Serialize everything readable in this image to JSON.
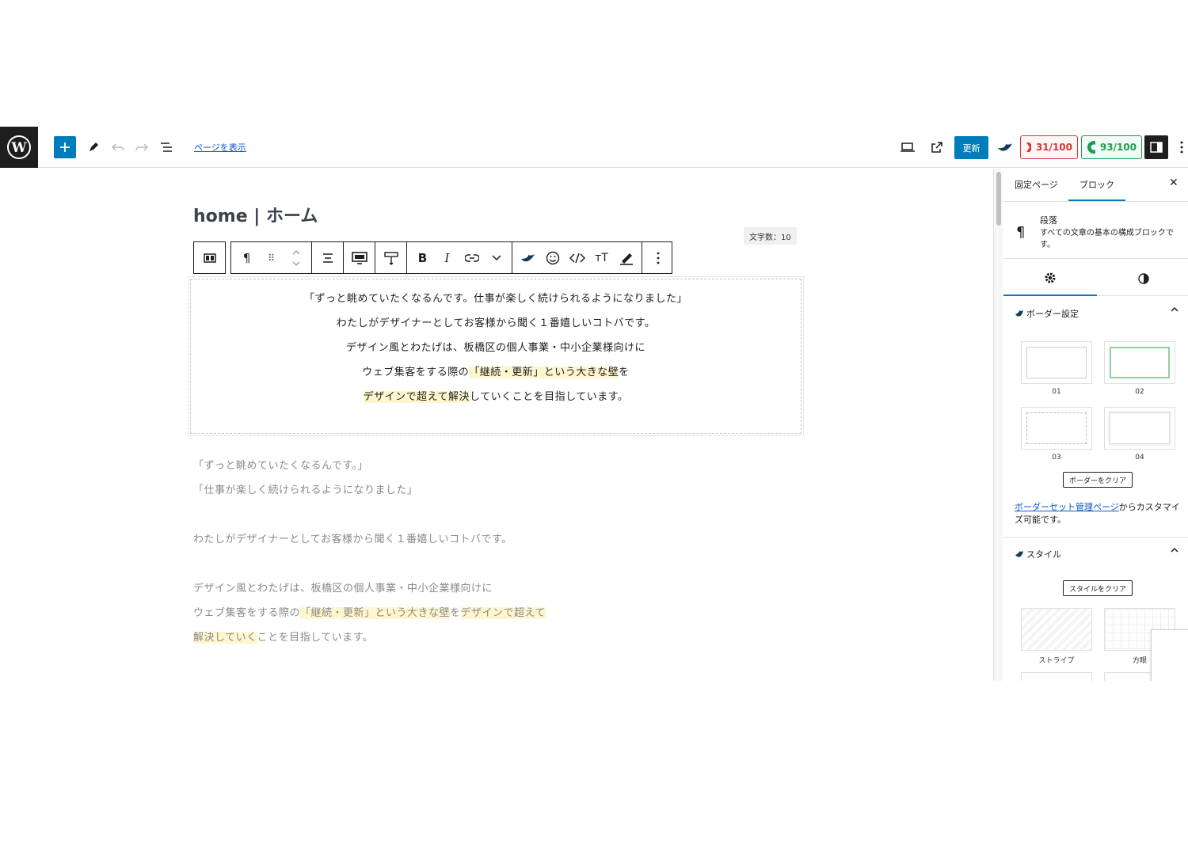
{
  "header": {
    "view_page_link": "ページを表示",
    "update_label": "更新",
    "seo_score_1": "31/100",
    "seo_score_2": "93/100"
  },
  "editor": {
    "page_title": "home | ホーム",
    "char_count": "文字数：10",
    "selected_block_lines": [
      "「ずっと眺めていたくなるんです。仕事が楽しく続けられるようになりました」",
      "わたしがデザイナーとしてお客様から聞く１番嬉しいコトバです。",
      "デザイン風とわたげは、板橋区の個人事業・中小企業様向けに",
      "ウェブ集客をする際の",
      "「継続・更新」という大きな壁",
      "を",
      "デザインで超えて解決",
      "していくことを目指しています。"
    ],
    "below_lines": [
      "「ずっと眺めていたくなるんです。」",
      "「仕事が楽しく続けられるようになりました」",
      "わたしがデザイナーとしてお客様から聞く１番嬉しいコトバです。",
      "デザイン風とわたげは、板橋区の個人事業・中小企業様向けに",
      "ウェブ集客をする際の",
      "「継続・更新」という大きな壁",
      "を",
      "デザインで超えて",
      "解決していく",
      "ことを目指しています。"
    ]
  },
  "inspector": {
    "tab_page": "固定ページ",
    "tab_block": "ブロック",
    "block_name": "段落",
    "block_description": "すべての文章の基本の構成ブロックです。",
    "border_panel_title": "ボーダー設定",
    "border_options": [
      "01",
      "02",
      "03",
      "04"
    ],
    "clear_border_label": "ボーダーをクリア",
    "border_link_text": "ボーダーセット管理ページ",
    "border_link_suffix": "からカスタマイズ可能です。",
    "style_panel_title": "スタイル",
    "clear_style_label": "スタイルをクリア",
    "style_options": [
      "ストライプ",
      "方眼"
    ]
  },
  "colors": {
    "accent": "#007cba",
    "dark": "#1e1e1e",
    "seo_red": "#d63638",
    "seo_green": "#1a9e4e",
    "highlight": "#fdf6cf"
  }
}
